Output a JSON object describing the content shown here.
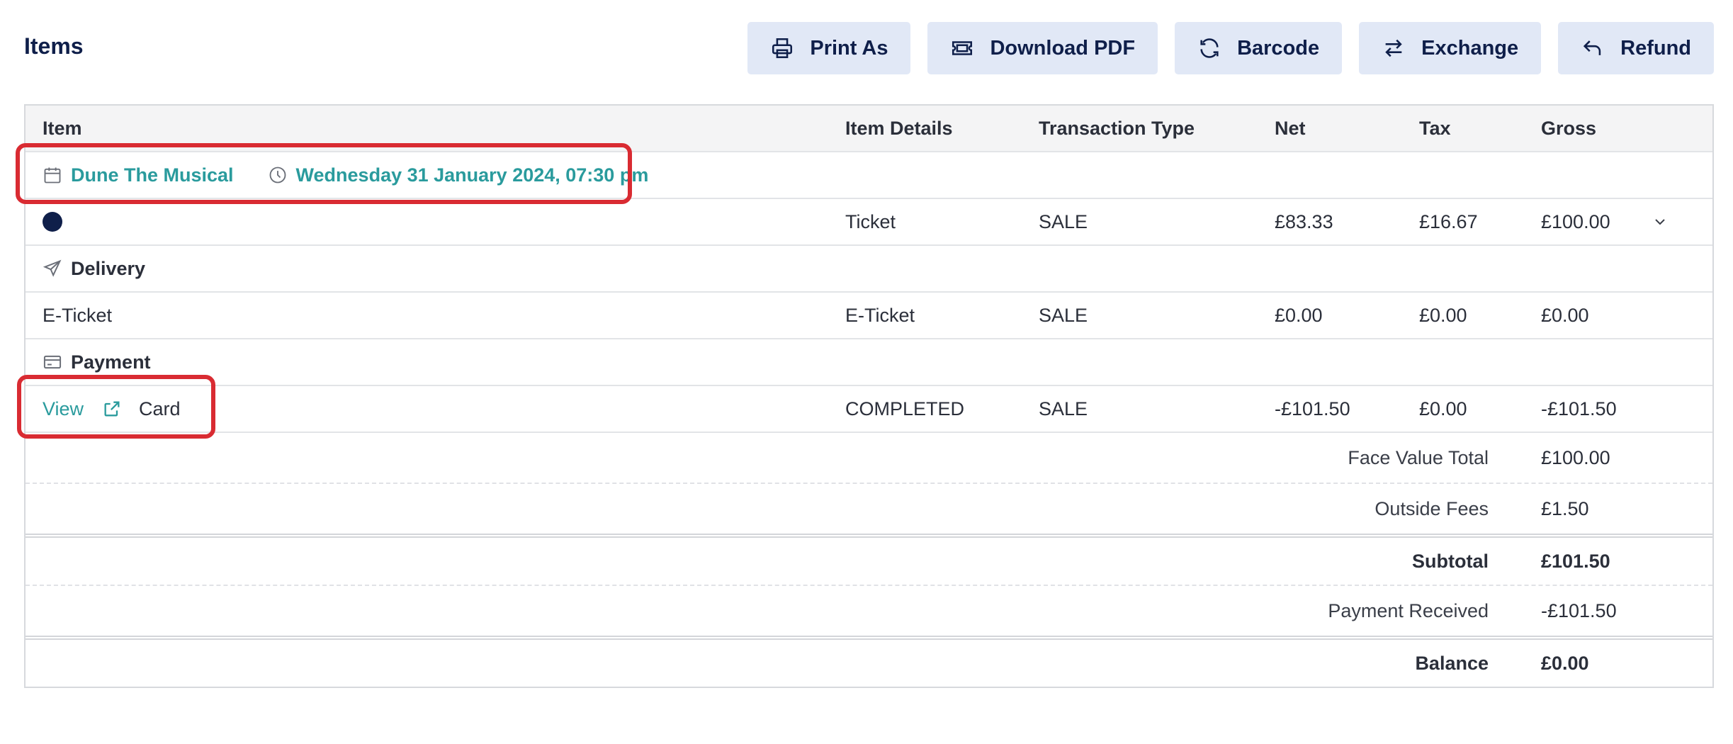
{
  "header": {
    "title": "Items"
  },
  "toolbar": [
    {
      "label": "Print As",
      "icon": "printer-icon"
    },
    {
      "label": "Download PDF",
      "icon": "ticket-icon"
    },
    {
      "label": "Barcode",
      "icon": "refresh-icon"
    },
    {
      "label": "Exchange",
      "icon": "exchange-icon"
    },
    {
      "label": "Refund",
      "icon": "undo-icon"
    }
  ],
  "table": {
    "columns": [
      "Item",
      "Item Details",
      "Transaction Type",
      "Net",
      "Tax",
      "Gross"
    ],
    "event": {
      "name": "Dune The Musical",
      "datetime": "Wednesday 31 January 2024, 07:30 pm"
    },
    "ticket_row": {
      "details": "Ticket",
      "type": "SALE",
      "net": "£83.33",
      "tax": "£16.67",
      "gross": "£100.00"
    },
    "delivery": {
      "section_label": "Delivery",
      "item": "E-Ticket",
      "details": "E-Ticket",
      "type": "SALE",
      "net": "£0.00",
      "tax": "£0.00",
      "gross": "£0.00"
    },
    "payment": {
      "section_label": "Payment",
      "view_label": "View",
      "method": "Card",
      "details": "COMPLETED",
      "type": "SALE",
      "net": "-£101.50",
      "tax": "£0.00",
      "gross": "-£101.50"
    }
  },
  "summary": {
    "face_value_label": "Face Value Total",
    "face_value": "£100.00",
    "outside_fees_label": "Outside Fees",
    "outside_fees": "£1.50",
    "subtotal_label": "Subtotal",
    "subtotal": "£101.50",
    "payment_received_label": "Payment Received",
    "payment_received": "-£101.50",
    "balance_label": "Balance",
    "balance": "£0.00"
  },
  "colors": {
    "accent": "#2a9b9d",
    "navy": "#0f1f4a",
    "button_bg": "#e1e8f6",
    "highlight": "#d92b32"
  }
}
